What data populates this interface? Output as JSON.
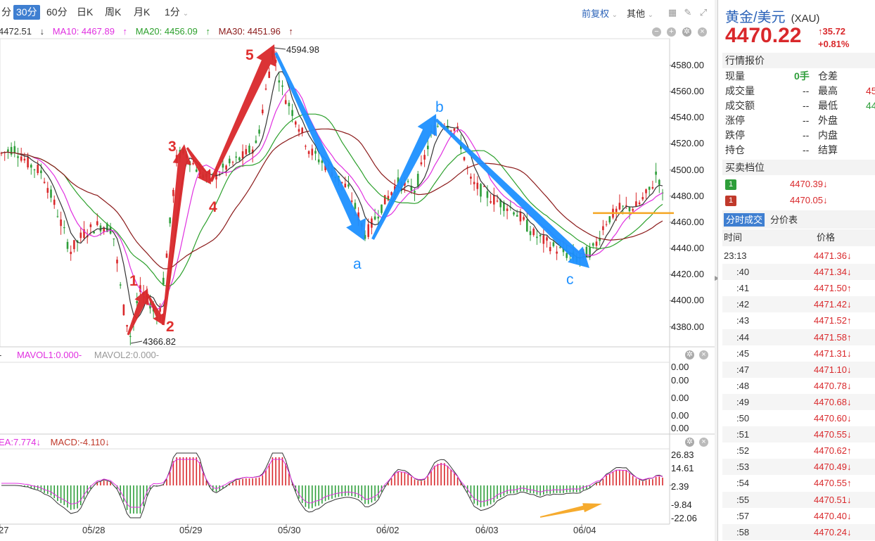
{
  "toolbar": {
    "periods": [
      "分",
      "30分",
      "60分",
      "日K",
      "周K",
      "月K",
      "1分"
    ],
    "active": "30分",
    "restore": "前复权",
    "other": "其他"
  },
  "ma": {
    "ma5": "4472.51",
    "ma10": "MA10: 4467.89",
    "ma20": "MA20: 4456.09",
    "ma30": "MA30: 4451.96"
  },
  "colors": {
    "ma5": "#333333",
    "ma10": "#e030e0",
    "ma20": "#2ca02c",
    "ma30": "#8b1a1a",
    "up": "#d9282b",
    "down": "#2e9e3a",
    "blue": "#1e90ff",
    "orange": "#f5a623"
  },
  "chart_data": {
    "type": "candlestick",
    "title": "黄金/美元 (XAU) 30分",
    "y_ticks": [
      4580.0,
      4560.0,
      4540.0,
      4520.0,
      4500.0,
      4480.0,
      4460.0,
      4440.0,
      4420.0,
      4400.0,
      4380.0
    ],
    "y_tick_labels": [
      "4580.00",
      "4560.00",
      "4540.00",
      "4520.00",
      "4500.00",
      "4480.00",
      "4460.00",
      "4440.00",
      "4420.00",
      "4400.00",
      "4380.00"
    ],
    "ylim": [
      4362,
      4600
    ],
    "x_labels": [
      "27",
      "05/28",
      "05/29",
      "05/30",
      "06/02",
      "06/03",
      "06/04"
    ],
    "annotations": {
      "high": "4594.98",
      "low": "4366.82"
    },
    "key_points": [
      {
        "label": "1",
        "value": 4411,
        "time": "05/28"
      },
      {
        "label": "2",
        "value": 4383,
        "time": "05/28"
      },
      {
        "label": "3",
        "value": 4516,
        "time": "05/29"
      },
      {
        "label": "4",
        "value": 4490,
        "time": "05/29"
      },
      {
        "label": "5",
        "value": 4594.98,
        "time": "05/30"
      },
      {
        "label": "a",
        "value": 4446,
        "time": "05/30"
      },
      {
        "label": "b",
        "value": 4540,
        "time": "06/02"
      },
      {
        "label": "c",
        "value": 4423,
        "time": "06/03"
      }
    ],
    "wave_labels_red": [
      "1",
      "2",
      "3",
      "4",
      "5"
    ],
    "wave_labels_blue": [
      "a",
      "b",
      "c"
    ],
    "level_line": 4467,
    "vol_panel": {
      "labels": [
        "-",
        "MAVOL1:0.000-",
        "MAVOL2:0.000-"
      ],
      "y_labels": [
        "0.00",
        "0.00",
        "0.00",
        "0.00",
        "0.00"
      ]
    },
    "macd_panel": {
      "labels": [
        "EA:7.774↓",
        "MACD:-4.110↓"
      ],
      "y_labels": [
        "26.83",
        "14.61",
        "2.39",
        "-9.84",
        "-22.06"
      ]
    }
  },
  "side": {
    "title": "黄金/美元",
    "code": "(XAU)",
    "price": "4470.22",
    "change": "↑35.72",
    "change_pct": "+0.81%",
    "quote_header": "行情报价",
    "quote": [
      {
        "k": "现量",
        "v": "0手",
        "k2": "仓差",
        "v2": ""
      },
      {
        "k": "成交量",
        "v": "--",
        "k2": "最高",
        "v2": "45"
      },
      {
        "k": "成交额",
        "v": "--",
        "k2": "最低",
        "v2": "44"
      },
      {
        "k": "涨停",
        "v": "--",
        "k2": "外盘",
        "v2": ""
      },
      {
        "k": "跌停",
        "v": "--",
        "k2": "内盘",
        "v2": ""
      },
      {
        "k": "持仓",
        "v": "--",
        "k2": "结算",
        "v2": ""
      }
    ],
    "levels_header": "买卖档位",
    "levels": [
      {
        "n": "1",
        "price": "4470.39↓",
        "color": "#2e9e3a"
      },
      {
        "n": "1",
        "price": "4470.05↓",
        "color": "#c0392b"
      }
    ],
    "tab_active": "分时成交",
    "tab_other": "分价表",
    "col_time": "时间",
    "col_price": "价格",
    "trades": [
      {
        "t": "23:13",
        "p": "4471.36↓"
      },
      {
        "t": ":40",
        "p": "4471.34↓"
      },
      {
        "t": ":41",
        "p": "4471.50↑"
      },
      {
        "t": ":42",
        "p": "4471.42↓"
      },
      {
        "t": ":43",
        "p": "4471.52↑"
      },
      {
        "t": ":44",
        "p": "4471.58↑"
      },
      {
        "t": ":45",
        "p": "4471.31↓"
      },
      {
        "t": ":47",
        "p": "4471.10↓"
      },
      {
        "t": ":48",
        "p": "4470.78↓"
      },
      {
        "t": ":49",
        "p": "4470.68↓"
      },
      {
        "t": ":50",
        "p": "4470.60↓"
      },
      {
        "t": ":51",
        "p": "4470.55↓"
      },
      {
        "t": ":52",
        "p": "4470.62↑"
      },
      {
        "t": ":53",
        "p": "4470.49↓"
      },
      {
        "t": ":54",
        "p": "4470.55↑"
      },
      {
        "t": ":55",
        "p": "4470.51↓"
      },
      {
        "t": ":57",
        "p": "4470.40↓"
      },
      {
        "t": ":58",
        "p": "4470.24↓"
      }
    ]
  }
}
